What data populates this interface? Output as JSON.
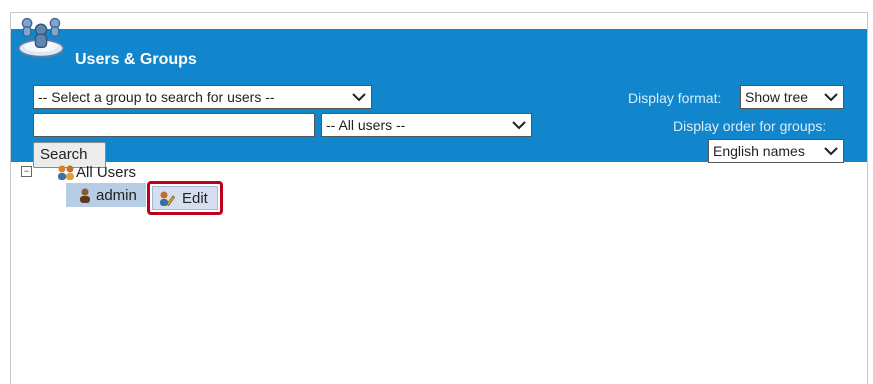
{
  "panel": {
    "title": "Users & Groups",
    "group_select": {
      "selected": "-- Select a group to search for users --"
    },
    "search_input": {
      "value": ""
    },
    "users_select": {
      "selected": "-- All users --"
    },
    "search_button": "Search",
    "display_format": {
      "label": "Display format:",
      "selected": "Show tree"
    },
    "display_order": {
      "label": "Display order for groups:",
      "selected": "English names"
    }
  },
  "tree": {
    "root": {
      "label": "All Users",
      "expander": "⊟"
    },
    "children": [
      {
        "label": "admin",
        "action": "Edit"
      }
    ]
  },
  "colors": {
    "header": "#1186cc",
    "highlight": "#c0001a",
    "selected_row": "#b7cde6"
  }
}
